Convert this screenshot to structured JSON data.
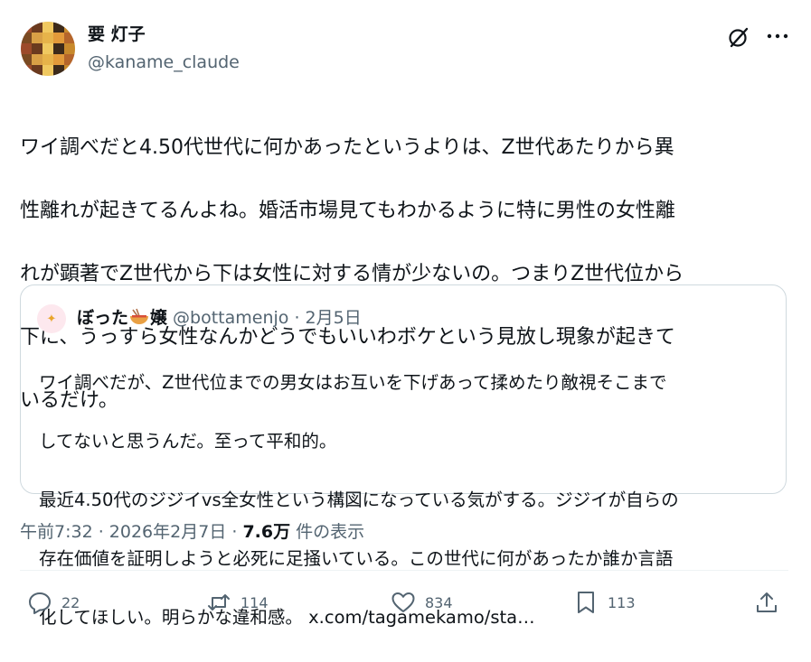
{
  "author": {
    "display_name": "要 灯子",
    "handle": "@kaname_claude"
  },
  "tweet": {
    "text": "ワイ調べだと4.50代世代に何かあったというよりは、Z世代あたりから異性離れが起きてるんよね。婚活市場見てもわかるように特に男性の女性離れが顕著でZ世代から下は女性に対する情が少ないの。つまりZ世代位から下に、うっすら女性なんかどうでもいいわボケという見放し現象が起きているだけ。",
    "text_lines": [
      "ワイ調べだと4.50代世代に何かあったというよりは、Z世代あたりから異",
      "性離れが起きてるんよね。婚活市場見てもわかるように特に男性の女性離",
      "れが顕著でZ世代から下は女性に対する情が少ないの。つまりZ世代位から",
      "下に、うっすら女性なんかどうでもいいわボケという見放し現象が起きて",
      "いるだけ。"
    ]
  },
  "quote": {
    "name_prefix": "ぼった",
    "name_suffix": "嬢",
    "handle": "@bottamenjo",
    "date": "· 2月5日",
    "text_lines": [
      "ワイ調べだが、Z世代位までの男女はお互いを下げあって揉めたり敵視そこまで",
      "してないと思うんだ。至って平和的。",
      "最近4.50代のジジイvs全女性という構図になっている気がする。ジジイが自らの",
      "存在価値を証明しようと必死に足掻いている。この世代に何があったか誰か言語",
      "化してほしい。明らかな違和感。 x.com/tagamekamo/sta…"
    ]
  },
  "meta": {
    "time_date": "午前7:32 · 2026年2月7日 · ",
    "views_count": "7.6万",
    "views_label": " 件の表示"
  },
  "actions": {
    "replies": "22",
    "reposts": "114",
    "likes": "834",
    "bookmarks": "113"
  },
  "icons": [
    "grok-icon",
    "more-icon",
    "reply-icon",
    "repost-icon",
    "like-icon",
    "bookmark-icon",
    "share-icon"
  ],
  "colors": {
    "text": "#0f1419",
    "secondary": "#536471",
    "border": "#cfd9de"
  }
}
